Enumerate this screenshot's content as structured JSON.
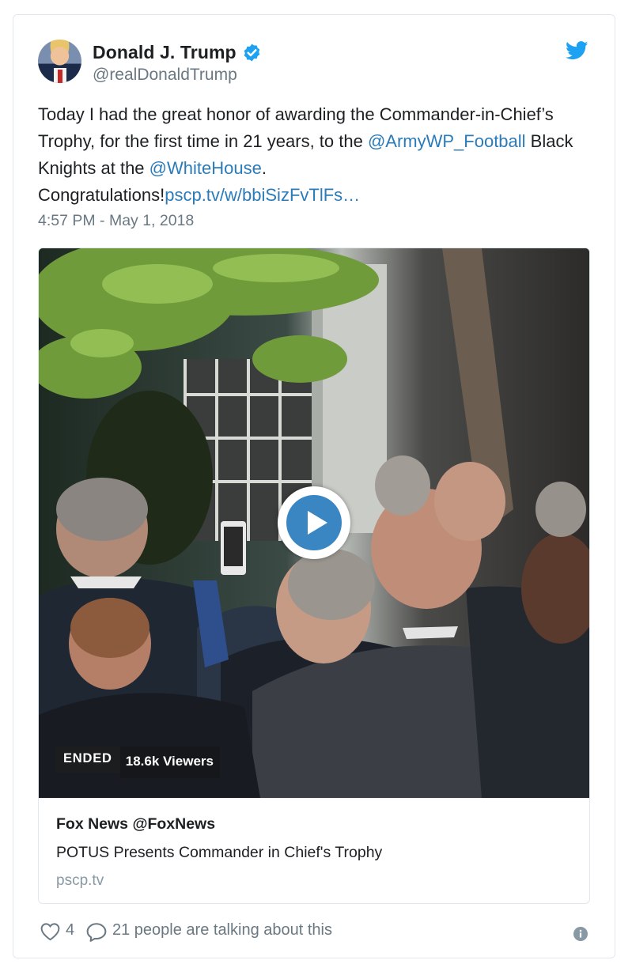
{
  "author": {
    "name": "Donald J. Trump",
    "handle": "@realDonaldTrump"
  },
  "tweet": {
    "text_1": "Today I had the great honor of awarding the Commander-in-Chief’s Trophy, for the first time in 21 years, to the ",
    "mention_1": "@ArmyWP_Football",
    "text_2": " Black Knights at the ",
    "mention_2": "@WhiteHouse",
    "text_3": ". Congratulations!",
    "link": "pscp.tv/w/bbiSizFvTlFs…",
    "timestamp": "4:57 PM - May 1, 2018"
  },
  "card": {
    "status_badge": "ENDED",
    "viewers": "18.6k Viewers",
    "title": "Fox News @FoxNews",
    "description": "POTUS Presents Commander in Chief's Trophy",
    "domain": "pscp.tv"
  },
  "footer": {
    "likes": "4",
    "talking": "21 people are talking about this"
  },
  "colors": {
    "link": "#2b7bb9",
    "verified": "#1da1f2",
    "twitter_brand": "#1da1f2",
    "play_button": "#3a86c2",
    "muted_text": "#697882"
  }
}
